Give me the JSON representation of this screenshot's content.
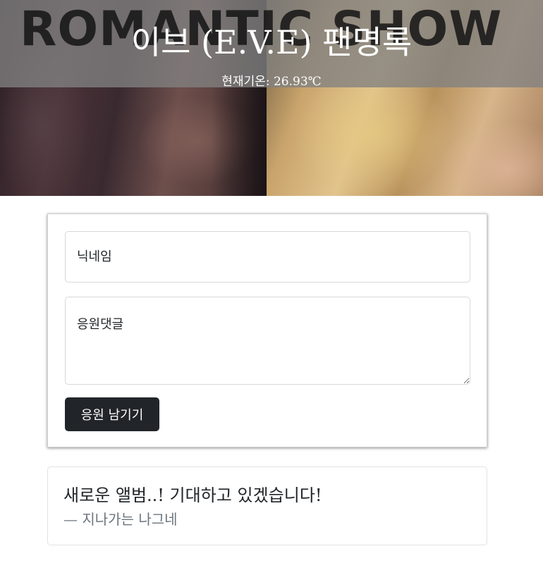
{
  "banner": {
    "image_text": "ROMANTIC SHOW",
    "title": "이브 (E.V.E) 팬명록",
    "temperature": "현재기온: 26.93℃"
  },
  "form": {
    "nickname_placeholder": "닉네임",
    "comment_placeholder": "응원댓글",
    "submit_label": "응원 남기기"
  },
  "comments": [
    {
      "text": "새로운 앨범..! 기대하고 있겠습니다!",
      "author": "— 지나가는 나그네"
    }
  ],
  "colors": {
    "button_bg": "#212529",
    "author_text": "#6c757d",
    "banner_overlay": "#828282"
  }
}
